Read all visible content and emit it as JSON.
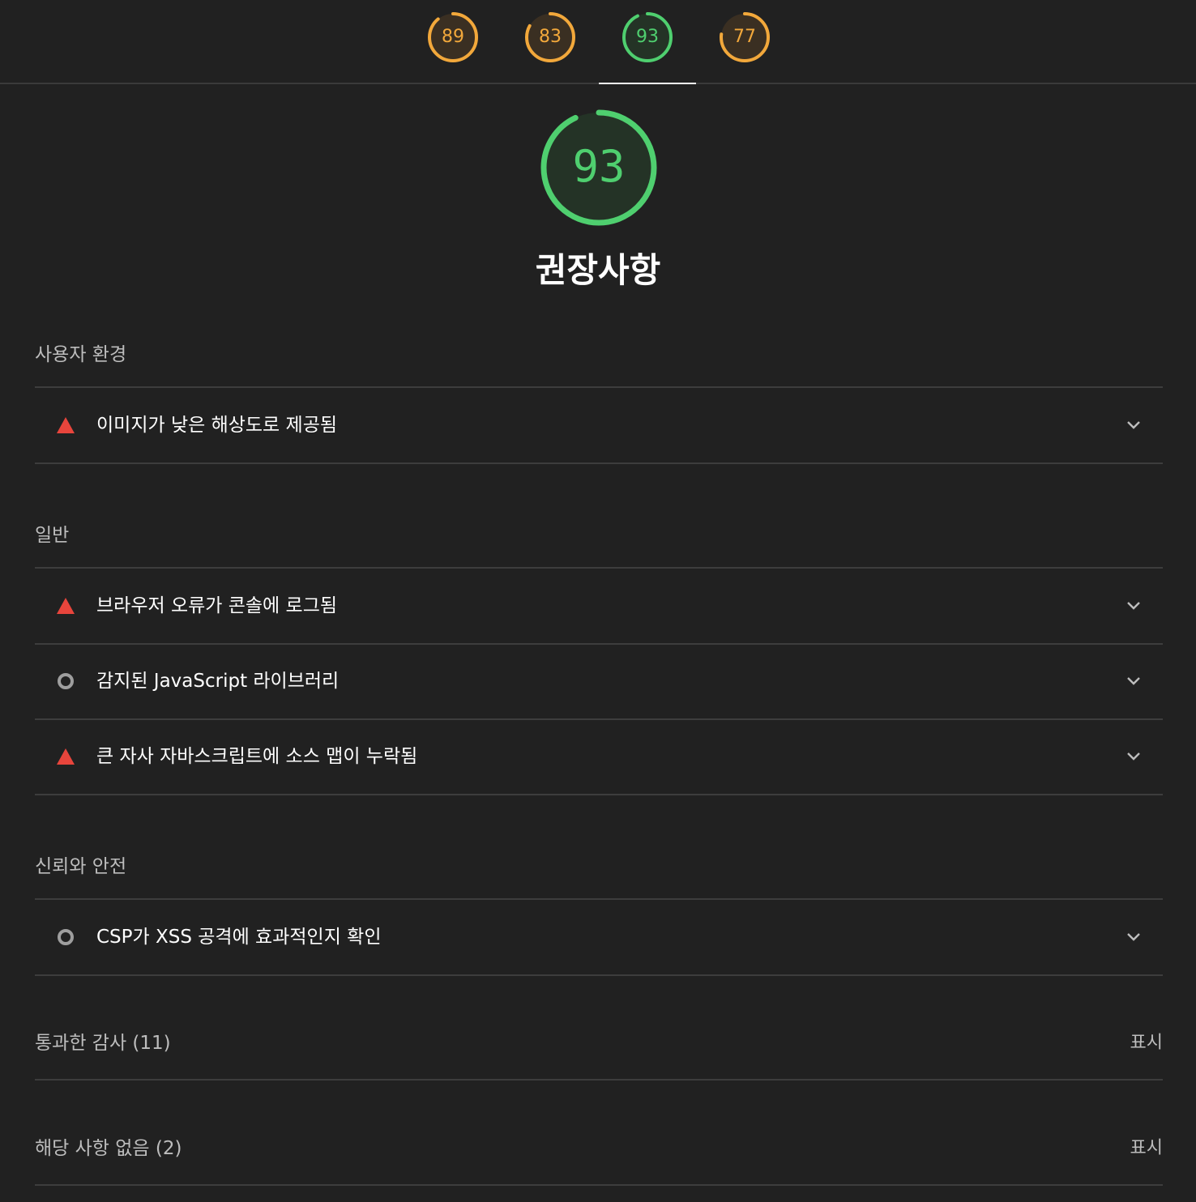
{
  "tabs": [
    {
      "score": "89",
      "color": "#f2a83b",
      "fraction": 0.89
    },
    {
      "score": "83",
      "color": "#f2a83b",
      "fraction": 0.83
    },
    {
      "score": "93",
      "color": "#4fcf6f",
      "fraction": 0.93,
      "active": true
    },
    {
      "score": "77",
      "color": "#f2a83b",
      "fraction": 0.77
    }
  ],
  "category": {
    "score": "93",
    "score_fraction": 0.93,
    "color": "#4fcf6f",
    "title": "권장사항"
  },
  "groups": {
    "ux": {
      "title": "사용자 환경",
      "audits": [
        {
          "label": "이미지가 낮은 해상도로 제공됨",
          "icon": "warning-triangle-icon"
        }
      ]
    },
    "general": {
      "title": "일반",
      "audits": [
        {
          "label": "브라우저 오류가 콘솔에 로그됨",
          "icon": "warning-triangle-icon"
        },
        {
          "label": "감지된 JavaScript 라이브러리",
          "icon": "info-circle-icon"
        },
        {
          "label": "큰 자사 자바스크립트에 소스 맵이 누락됨",
          "icon": "warning-triangle-icon"
        }
      ]
    },
    "trust": {
      "title": "신뢰와 안전",
      "audits": [
        {
          "label": "CSP가 XSS 공격에 효과적인지 확인",
          "icon": "info-circle-icon"
        }
      ]
    }
  },
  "passed": {
    "label": "통과한 감사 (11)",
    "button": "표시"
  },
  "not_applicable": {
    "label": "해당 사항 없음 (2)",
    "button": "표시"
  },
  "colors": {
    "fail": "#e8453c",
    "info": "#9e9e9e",
    "divider": "#3d3d3d"
  }
}
